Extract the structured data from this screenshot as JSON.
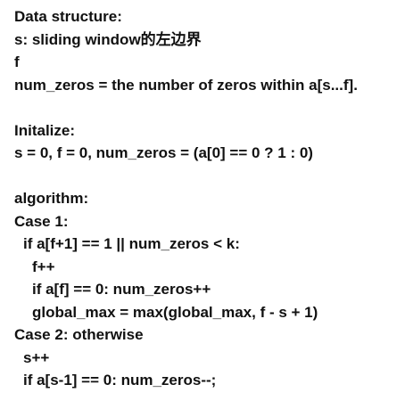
{
  "lines": [
    {
      "text": "Data structure:",
      "indent": 0
    },
    {
      "text": "s: sliding window的左边界",
      "indent": 0
    },
    {
      "text": "f",
      "indent": 0
    },
    {
      "text": "num_zeros = the number of zeros within a[s...f].",
      "indent": 0
    },
    {
      "text": "",
      "indent": 0
    },
    {
      "text": "Initalize:",
      "indent": 0
    },
    {
      "text": "s = 0, f = 0, num_zeros = (a[0] == 0 ? 1 : 0)",
      "indent": 0
    },
    {
      "text": "",
      "indent": 0
    },
    {
      "text": "algorithm:",
      "indent": 0
    },
    {
      "text": "Case 1:",
      "indent": 0
    },
    {
      "text": "if a[f+1] == 1 || num_zeros < k:",
      "indent": 1
    },
    {
      "text": "f++",
      "indent": 2
    },
    {
      "text": "if a[f] == 0: num_zeros++",
      "indent": 2
    },
    {
      "text": "global_max = max(global_max, f - s + 1)",
      "indent": 2
    },
    {
      "text": "Case 2: otherwise",
      "indent": 0
    },
    {
      "text": "s++",
      "indent": 1
    },
    {
      "text": "if a[s-1] == 0: num_zeros--;",
      "indent": 1
    }
  ]
}
